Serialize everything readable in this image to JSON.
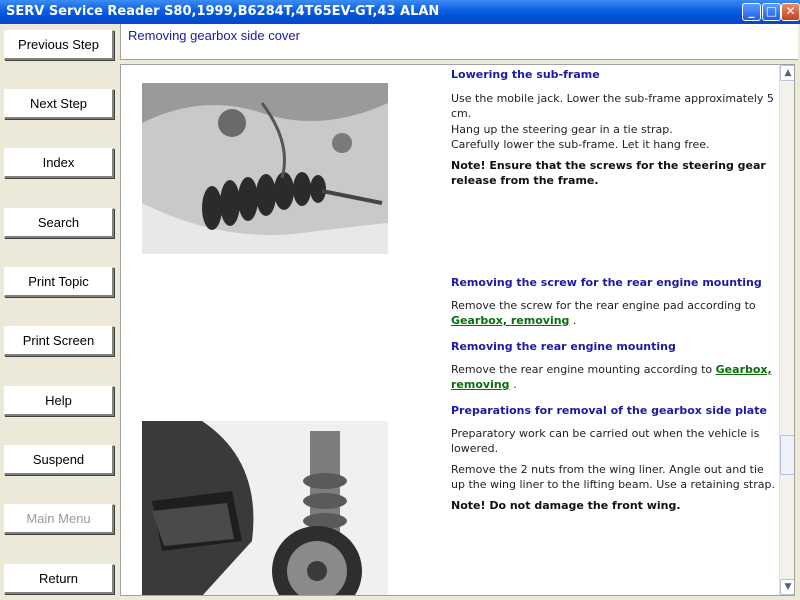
{
  "window": {
    "title": "SERV Service Reader S80,1999,B6284T,4T65EV-GT,43 ALAN",
    "min_label": "_",
    "max_label": "□",
    "close_label": "✕"
  },
  "nav": [
    {
      "label": "Previous Step",
      "enabled": true
    },
    {
      "label": "Next Step",
      "enabled": true
    },
    {
      "label": "Index",
      "enabled": true
    },
    {
      "label": "Search",
      "enabled": true
    },
    {
      "label": "Print Topic",
      "enabled": true
    },
    {
      "label": "Print Screen",
      "enabled": true
    },
    {
      "label": "Help",
      "enabled": true
    },
    {
      "label": "Suspend",
      "enabled": true
    },
    {
      "label": "Main Menu",
      "enabled": false
    },
    {
      "label": "Return",
      "enabled": true
    }
  ],
  "banner": {
    "title": "Removing gearbox side cover"
  },
  "content": {
    "s1": {
      "heading": "Lowering the sub-frame",
      "lines": [
        "Use the mobile jack. Lower the sub-frame approximately 5 cm.",
        "Hang up the steering gear in a tie strap.",
        "Carefully lower the sub-frame. Let it hang free."
      ],
      "note": "Note! Ensure that the screws for the steering gear release from the frame."
    },
    "s2": {
      "heading": "Removing the screw for the rear engine mounting",
      "text": "Remove the screw for the rear engine pad according to",
      "link": "Gearbox, removing",
      "after": "."
    },
    "s3": {
      "heading": "Removing the rear engine mounting",
      "text": "Remove the rear engine mounting according to",
      "link": "Gearbox, removing",
      "after": "."
    },
    "s4": {
      "heading": "Preparations for removal of the gearbox side plate",
      "line1": "Preparatory work can be carried out when the vehicle is lowered.",
      "line2": "Remove the 2 nuts from the wing liner. Angle out and tie up the wing liner to the lifting beam. Use a retaining strap.",
      "note": "Note! Do not damage the front wing."
    }
  },
  "scrollbar": {
    "up": "▲",
    "down": "▼"
  }
}
